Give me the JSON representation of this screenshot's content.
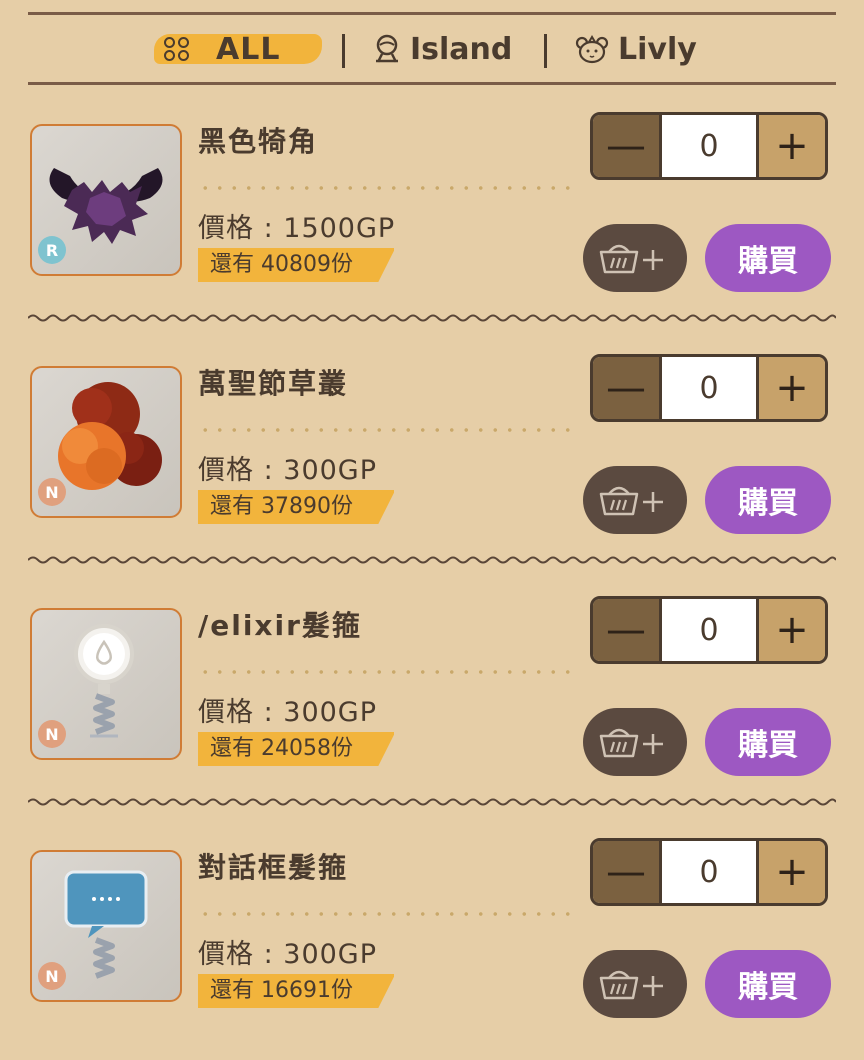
{
  "tabs": {
    "all": "ALL",
    "island": "Island",
    "livly": "Livly"
  },
  "colors": {
    "accent_yellow": "#f2b43c",
    "buy_purple": "#9d58c2",
    "background": "#e6cea7",
    "rarity_r": "#7fc3cf",
    "rarity_n": "#e0a07e"
  },
  "items": [
    {
      "name": "黑色犄角",
      "price": "價格 : 1500GP",
      "stock": "還有 40809份",
      "quantity": "0",
      "rarity": "R",
      "buy_label": "購買",
      "image_icon": "black-horns-icon"
    },
    {
      "name": "萬聖節草叢",
      "price": "價格 : 300GP",
      "stock": "還有 37890份",
      "quantity": "0",
      "rarity": "N",
      "buy_label": "購買",
      "image_icon": "halloween-bush-icon"
    },
    {
      "name": "/elixir髮箍",
      "price": "價格 : 300GP",
      "stock": "還有 24058份",
      "quantity": "0",
      "rarity": "N",
      "buy_label": "購買",
      "image_icon": "elixir-headband-icon"
    },
    {
      "name": "對話框髮箍",
      "price": "價格 : 300GP",
      "stock": "還有 16691份",
      "quantity": "0",
      "rarity": "N",
      "buy_label": "購買",
      "image_icon": "speech-bubble-headband-icon"
    }
  ]
}
